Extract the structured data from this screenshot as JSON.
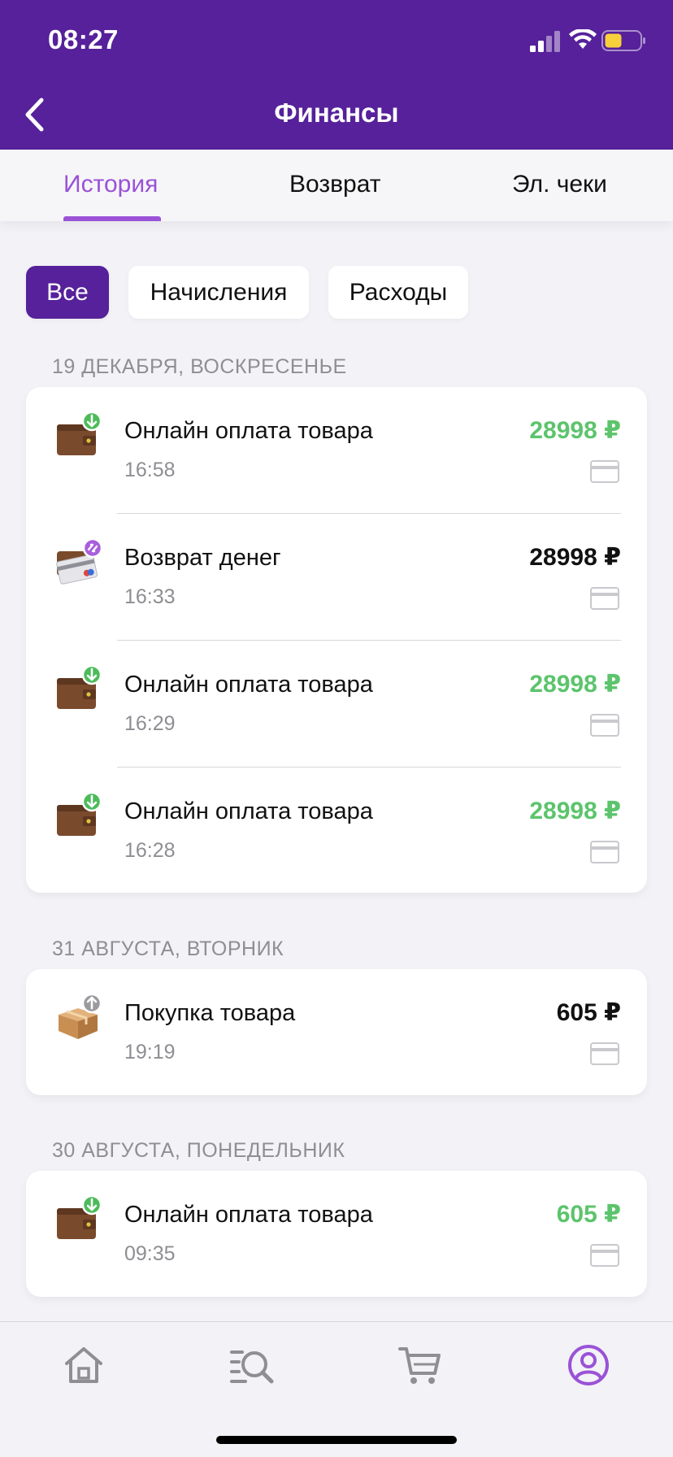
{
  "status_bar": {
    "time": "08:27"
  },
  "header": {
    "title": "Финансы"
  },
  "tabs": [
    {
      "label": "История",
      "active": true
    },
    {
      "label": "Возврат",
      "active": false
    },
    {
      "label": "Эл. чеки",
      "active": false
    }
  ],
  "filters": [
    {
      "label": "Все",
      "active": true
    },
    {
      "label": "Начисления",
      "active": false
    },
    {
      "label": "Расходы",
      "active": false
    }
  ],
  "groups": [
    {
      "date": "19 ДЕКАБРЯ, ВОСКРЕСЕНЬЕ",
      "items": [
        {
          "icon": "wallet-income-icon",
          "title": "Онлайн оплата товара",
          "time": "16:58",
          "amount": "28998 ₽",
          "amount_color": "#5cc46c"
        },
        {
          "icon": "refund-card-icon",
          "title": "Возврат денег",
          "time": "16:33",
          "amount": "28998 ₽",
          "amount_color": "#111111"
        },
        {
          "icon": "wallet-income-icon",
          "title": "Онлайн оплата товара",
          "time": "16:29",
          "amount": "28998 ₽",
          "amount_color": "#5cc46c"
        },
        {
          "icon": "wallet-income-icon",
          "title": "Онлайн оплата товара",
          "time": "16:28",
          "amount": "28998 ₽",
          "amount_color": "#5cc46c"
        }
      ]
    },
    {
      "date": "31 АВГУСТА, ВТОРНИК",
      "items": [
        {
          "icon": "box-purchase-icon",
          "title": "Покупка товара",
          "time": "19:19",
          "amount": "605 ₽",
          "amount_color": "#111111"
        }
      ]
    },
    {
      "date": "30 АВГУСТА, ПОНЕДЕЛЬНИК",
      "items": [
        {
          "icon": "wallet-income-icon",
          "title": "Онлайн оплата товара",
          "time": "09:35",
          "amount": "605 ₽",
          "amount_color": "#5cc46c"
        }
      ]
    }
  ],
  "bottom_nav": [
    {
      "icon": "home-icon",
      "active": false
    },
    {
      "icon": "catalog-search-icon",
      "active": false
    },
    {
      "icon": "cart-icon",
      "active": false
    },
    {
      "icon": "profile-icon",
      "active": true
    }
  ],
  "colors": {
    "brand": "#56219a",
    "accent": "#9a52d6",
    "income": "#5cc46c"
  }
}
